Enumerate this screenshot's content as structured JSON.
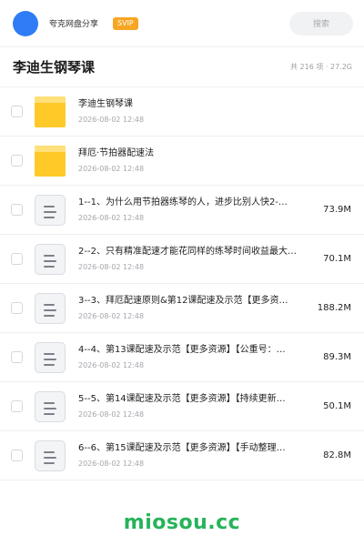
{
  "header": {
    "user_name": "夸克网盘分享",
    "badge": "SVIP",
    "search_placeholder": "搜索"
  },
  "folder": {
    "title": "李迪生钢琴课",
    "meta": "共 216 项 · 27.2G"
  },
  "items": [
    {
      "type": "folder",
      "icon": "folder-icon",
      "name": "李迪生钢琴课",
      "date": "2026-08-02 12:48",
      "size": ""
    },
    {
      "type": "folder",
      "icon": "folder-icon",
      "name": "拜厄·节拍器配速法",
      "date": "2026-08-02 12:48",
      "size": ""
    },
    {
      "type": "file",
      "icon": "document-icon",
      "name": "1--1、为什么用节拍器练琴的人，进步比别人快2-…",
      "date": "2026-08-02 12:48",
      "size": "73.9M"
    },
    {
      "type": "file",
      "icon": "document-icon",
      "name": "2--2、只有精准配速才能花同样的练琴时间收益最大…",
      "date": "2026-08-02 12:48",
      "size": "70.1M"
    },
    {
      "type": "file",
      "icon": "document-icon",
      "name": "3--3、拜厄配速原则&第12课配速及示范【更多资…",
      "date": "2026-08-02 12:48",
      "size": "188.2M"
    },
    {
      "type": "file",
      "icon": "document-icon",
      "name": "4--4、第13课配速及示范【更多资源】【公重号：…",
      "date": "2026-08-02 12:48",
      "size": "89.3M"
    },
    {
      "type": "file",
      "icon": "document-icon",
      "name": "5--5、第14课配速及示范【更多资源】【持续更新…",
      "date": "2026-08-02 12:48",
      "size": "50.1M"
    },
    {
      "type": "file",
      "icon": "document-icon",
      "name": "6--6、第15课配速及示范【更多资源】【手动整理…",
      "date": "2026-08-02 12:48",
      "size": "82.8M"
    }
  ],
  "watermark": "miosou.cc",
  "colors": {
    "accent": "#2f7cf6",
    "svip": "#f5a623",
    "folder": "#ffc928",
    "watermark": "#27b35a"
  }
}
